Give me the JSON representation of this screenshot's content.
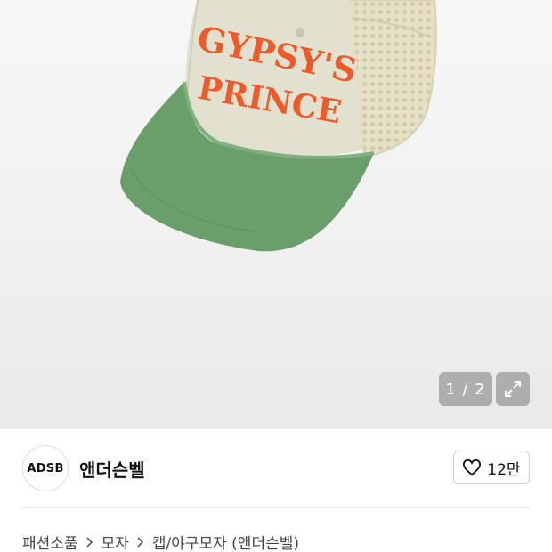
{
  "gallery": {
    "image_alt": "green and beige trucker cap",
    "embroidery_line1": "GYPSY'S",
    "embroidery_line2": "PRINCE",
    "counter_current": "1",
    "counter_total": "2",
    "counter_separator": " / ",
    "expand_icon": "expand-arrows-icon"
  },
  "seller": {
    "logo_text": "ADSB",
    "name": "앤더슨벨",
    "like_icon": "heart-outline-icon",
    "like_count": "12만"
  },
  "breadcrumb": {
    "items": [
      "패션소품",
      "모자",
      "캡/야구모자 (앤더슨벨)"
    ],
    "separator_icon": "chevron-right-icon"
  },
  "colors": {
    "brim_green": "#6a9f6c",
    "crown_beige": "#e2e0cf",
    "embroidery_orange": "#f05a2a",
    "overlay_gray": "#969696"
  }
}
